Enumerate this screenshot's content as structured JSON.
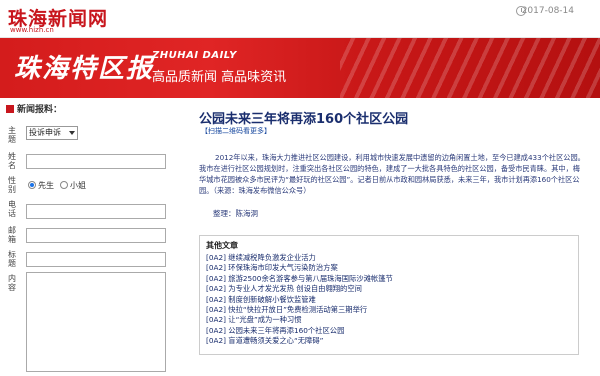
{
  "topbar": {
    "logo": "珠海新闻网",
    "url": "www.hizh.cn",
    "date": "2017-08-14"
  },
  "banner": {
    "calligraphy": "珠海特区报",
    "english": "ZHUHAI DAILY",
    "slogan": "高品质新闻 高品味资讯",
    "colors": {
      "primary": "#d41c1c",
      "dark": "#b41010"
    }
  },
  "form": {
    "title": "新闻报料：",
    "labels": {
      "topic": "主题",
      "name": "姓名",
      "gender": "性别",
      "phone": "电话",
      "email": "邮箱",
      "subject": "标题",
      "content": "内容"
    },
    "topic_select": "投诉申诉",
    "gender_options": {
      "male": "先生",
      "female": "小姐"
    }
  },
  "article": {
    "title": "公园未来三年将再添160个社区公园",
    "qr_link": "【扫描二维码看更多】",
    "body": "2012年以来，珠海大力推进社区公园建设，利用城市快速发展中遗留的边角闲置土地，至今已建成433个社区公园。我市在进行社区公园规划时，注重突出各社区公园的特色，建成了一大批各具特色的社区公园，备受市民青睐。其中，梅华城市花园被众多市民评为“最好玩的社区公园”。记者日前从市政和园林局获悉，未来三年，我市计划再添160个社区公园。（来源：珠海发布微信公众号）",
    "editor": "整理：陈海洞"
  },
  "related": {
    "title": "其他文章",
    "items": [
      "[0A2] 继续减税降负激发企业活力",
      "[0A2] 环保珠海市印发大气污染防治方案",
      "[0A2] 旅游2500余名游客参与第八届珠海国际沙滩帐篷节",
      "[0A2] 为专业人才发光发热 创设自由翱翔的空间",
      "[0A2] 制度创新破解小餐饮监管难",
      "[0A2] 快拉“快拉开放日”免费检测活动第三期举行",
      "[0A2] 让“光盘”成为一种习惯",
      "[0A2] 公园未来三年将再添160个社区公园",
      "[0A2] 盲道遭畅须关爱之心“无障碍”"
    ]
  }
}
